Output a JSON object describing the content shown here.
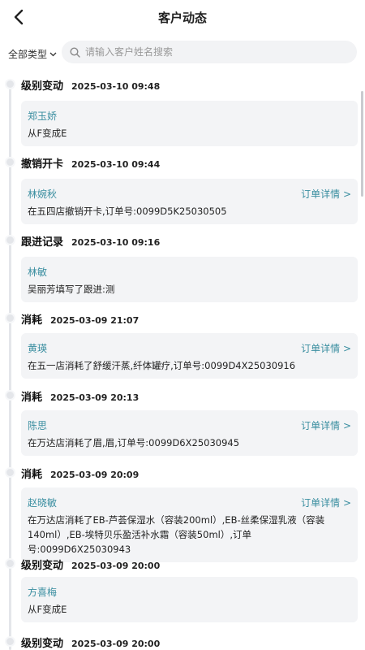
{
  "header": {
    "title": "客户动态"
  },
  "filter": {
    "type_label": "全部类型",
    "search_placeholder": "请输入客户姓名搜索"
  },
  "events": [
    {
      "type": "级别变动",
      "time": "2025-03-10 09:48",
      "name": "郑玉娇",
      "desc": "从F变成E",
      "link": ""
    },
    {
      "type": "撤销开卡",
      "time": "2025-03-10 09:44",
      "name": "林婉秋",
      "desc": "在五四店撤销开卡,订单号:0099D5K25030505",
      "link": "订单详情 >"
    },
    {
      "type": "跟进记录",
      "time": "2025-03-10 09:16",
      "name": "林敏",
      "desc": "吴丽芳填写了跟进:测",
      "link": ""
    },
    {
      "type": "消耗",
      "time": "2025-03-09 21:07",
      "name": "黄瑛",
      "desc": "在五一店消耗了舒缓汗蒸,纤体罐疗,订单号:0099D4X25030916",
      "link": "订单详情 >"
    },
    {
      "type": "消耗",
      "time": "2025-03-09 20:13",
      "name": "陈思",
      "desc": "在万达店消耗了眉,眉,订单号:0099D6X25030945",
      "link": "订单详情 >"
    },
    {
      "type": "消耗",
      "time": "2025-03-09 20:09",
      "name": "赵晓敏",
      "desc": "在万达店消耗了EB-芦荟保湿水（容装200ml）,EB-丝柔保湿乳液（容装140ml）,EB-埃特贝乐盈活补水霜（容装50ml）,订单号:0099D6X25030943",
      "link": "订单详情 >"
    },
    {
      "type": "级别变动",
      "time": "2025-03-09 20:00",
      "name": "方喜梅",
      "desc": "从F变成E",
      "link": ""
    },
    {
      "type": "级别变动",
      "time": "2025-03-09 20:00",
      "name": "",
      "desc": "",
      "link": ""
    }
  ]
}
